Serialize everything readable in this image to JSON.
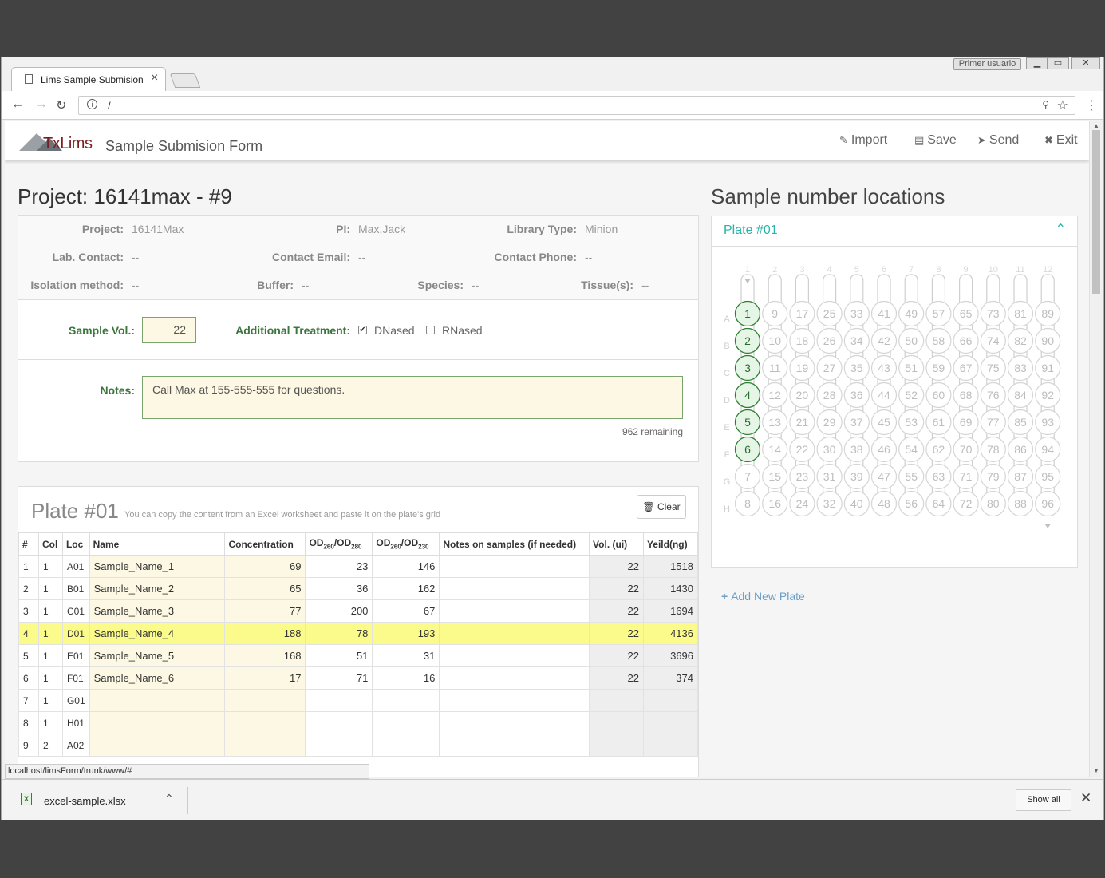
{
  "os": {
    "user_label": "Primer usuario",
    "minimize": "▁",
    "restore": "▭",
    "close": "✕"
  },
  "browser": {
    "tab_title": "Lims Sample Submision Fo",
    "tab_close": "×",
    "url": "/",
    "status_url": "localhost/limsForm/trunk/www/#"
  },
  "app": {
    "logo_text": "TxLims",
    "title": "Sample Submision Form",
    "actions": [
      {
        "label": "Import",
        "icon": "paperclip-icon",
        "glyph": "✎"
      },
      {
        "label": "Save",
        "icon": "floppy-icon",
        "glyph": "💾"
      },
      {
        "label": "Send",
        "icon": "send-icon",
        "glyph": "➤"
      },
      {
        "label": "Exit",
        "icon": "close-icon",
        "glyph": "✖"
      }
    ]
  },
  "project": {
    "heading": "Project: 16141max - #9",
    "fields": {
      "project_label": "Project:",
      "project_value": "16141Max",
      "pi_label": "PI:",
      "pi_value": "Max,Jack",
      "library_label": "Library Type:",
      "library_value": "Minion",
      "lab_contact_label": "Lab. Contact:",
      "lab_contact_value": "--",
      "email_label": "Contact Email:",
      "email_value": "--",
      "phone_label": "Contact Phone:",
      "phone_value": "--",
      "isolation_label": "Isolation method:",
      "isolation_value": "--",
      "buffer_label": "Buffer:",
      "buffer_value": "--",
      "species_label": "Species:",
      "species_value": "--",
      "tissue_label": "Tissue(s):",
      "tissue_value": "--"
    },
    "sample_vol_label": "Sample Vol.:",
    "sample_vol_value": "22",
    "treatment_label": "Additional Treatment:",
    "dnased_label": "DNased",
    "dnased_checked": true,
    "rnased_label": "RNased",
    "rnased_checked": false,
    "notes_label": "Notes:",
    "notes_value": "Call Max at 155-555-555 for questions.",
    "remaining": "962 remaining"
  },
  "plate": {
    "title": "Plate #01",
    "hint": "You can copy the content from an Excel worksheet and paste it on the plate's grid",
    "clear_label": "Clear",
    "columns": [
      "#",
      "Col",
      "Loc",
      "Name",
      "Concentration",
      "OD",
      "OD",
      "Notes on samples (if needed)",
      "Vol. (ui)",
      "Yeild(ng)"
    ],
    "od1": {
      "a": "OD",
      "a_sub": "260",
      "b": "/OD",
      "b_sub": "280"
    },
    "od2": {
      "a": "OD",
      "a_sub": "260",
      "b": "/OD",
      "b_sub": "230"
    },
    "rows": [
      {
        "n": "1",
        "col": "1",
        "loc": "A01",
        "name": "Sample_Name_1",
        "conc": "69",
        "od1": "23",
        "od2": "146",
        "notes": "",
        "vol": "22",
        "yield": "1518"
      },
      {
        "n": "2",
        "col": "1",
        "loc": "B01",
        "name": "Sample_Name_2",
        "conc": "65",
        "od1": "36",
        "od2": "162",
        "notes": "",
        "vol": "22",
        "yield": "1430"
      },
      {
        "n": "3",
        "col": "1",
        "loc": "C01",
        "name": "Sample_Name_3",
        "conc": "77",
        "od1": "200",
        "od2": "67",
        "notes": "",
        "vol": "22",
        "yield": "1694"
      },
      {
        "n": "4",
        "col": "1",
        "loc": "D01",
        "name": "Sample_Name_4",
        "conc": "188",
        "od1": "78",
        "od2": "193",
        "notes": "",
        "vol": "22",
        "yield": "4136"
      },
      {
        "n": "5",
        "col": "1",
        "loc": "E01",
        "name": "Sample_Name_5",
        "conc": "168",
        "od1": "51",
        "od2": "31",
        "notes": "",
        "vol": "22",
        "yield": "3696"
      },
      {
        "n": "6",
        "col": "1",
        "loc": "F01",
        "name": "Sample_Name_6",
        "conc": "17",
        "od1": "71",
        "od2": "16",
        "notes": "",
        "vol": "22",
        "yield": "374"
      },
      {
        "n": "7",
        "col": "1",
        "loc": "G01",
        "name": "",
        "conc": "",
        "od1": "",
        "od2": "",
        "notes": "",
        "vol": "",
        "yield": ""
      },
      {
        "n": "8",
        "col": "1",
        "loc": "H01",
        "name": "",
        "conc": "",
        "od1": "",
        "od2": "",
        "notes": "",
        "vol": "",
        "yield": ""
      },
      {
        "n": "9",
        "col": "2",
        "loc": "A02",
        "name": "",
        "conc": "",
        "od1": "",
        "od2": "",
        "notes": "",
        "vol": "",
        "yield": ""
      }
    ],
    "highlighted_row": 3
  },
  "locations": {
    "heading": "Sample number locations",
    "plate_label": "Plate #01",
    "col_labels": [
      "1",
      "2",
      "3",
      "4",
      "5",
      "6",
      "7",
      "8",
      "9",
      "10",
      "11",
      "12"
    ],
    "row_labels": [
      "A",
      "B",
      "C",
      "D",
      "E",
      "F",
      "G",
      "H"
    ],
    "filled_wells": [
      1,
      2,
      3,
      4,
      5,
      6
    ],
    "add_plate_label": "Add New Plate"
  },
  "downloads": {
    "file_name": "excel-sample.xlsx",
    "show_all": "Show all",
    "close": "✕"
  },
  "colors": {
    "accent": "#26b5a8",
    "filled_well": "#2e7d32",
    "highlight": "#fbfb8c"
  }
}
